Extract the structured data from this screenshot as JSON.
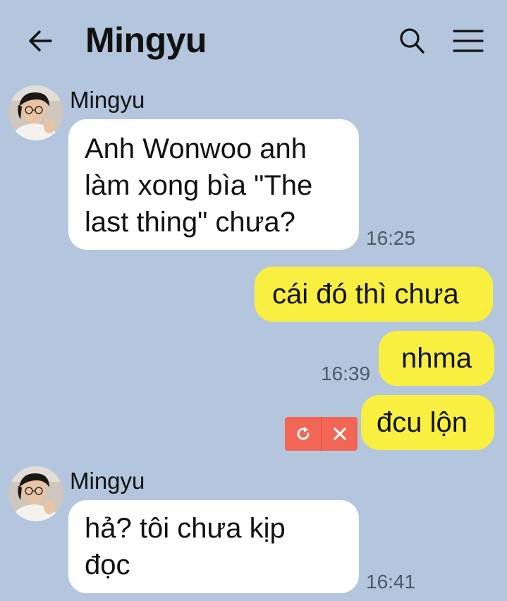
{
  "header": {
    "title": "Mingyu"
  },
  "messages": [
    {
      "sender": "Mingyu",
      "lines": [
        "Anh Wonwoo anh",
        "làm xong bìa \"The",
        "last thing\" chưa?"
      ],
      "time": "16:25"
    },
    {
      "text": "cái đó thì chưa"
    },
    {
      "text": "nhma",
      "time": "16:39"
    },
    {
      "text": "đcu lộn",
      "status": "failed"
    },
    {
      "sender": "Mingyu",
      "lines": [
        "hả? tôi chưa kịp",
        "đọc"
      ],
      "time": "16:41"
    }
  ],
  "icons": {
    "back": "arrow-left-icon",
    "search": "search-icon",
    "menu": "hamburger-menu-icon",
    "retry": "retry-icon",
    "delete": "close-icon"
  },
  "colors": {
    "background": "#b3c6dd",
    "incoming_bubble": "#ffffff",
    "outgoing_bubble": "#f9ef41",
    "failed_action": "#f26655"
  }
}
